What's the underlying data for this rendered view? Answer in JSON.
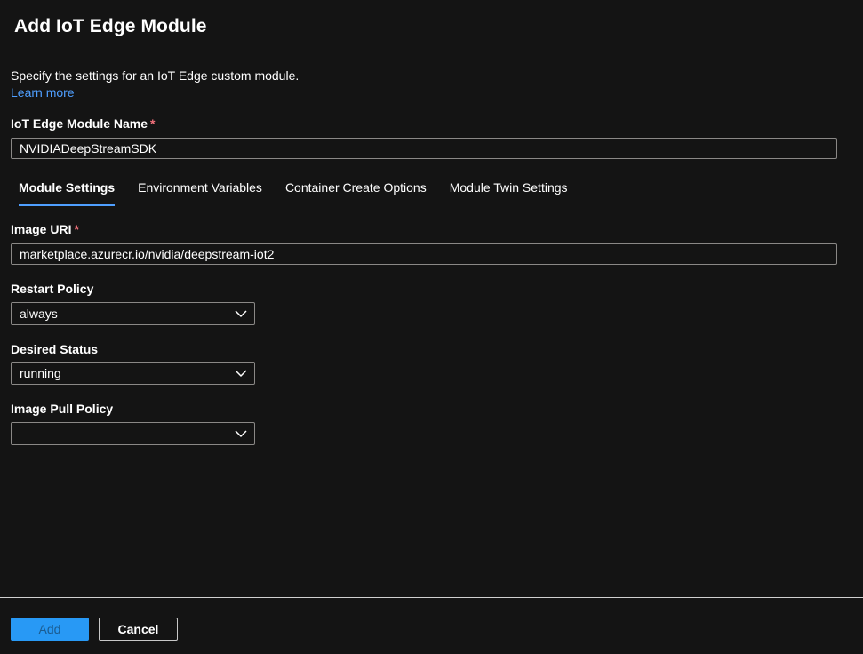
{
  "dialog": {
    "title": "Add IoT Edge Module",
    "description": "Specify the settings for an IoT Edge custom module.",
    "learn_more": "Learn more"
  },
  "module_name": {
    "label": "IoT Edge Module Name",
    "required_marker": "*",
    "value": "NVIDIADeepStreamSDK"
  },
  "tabs": [
    {
      "label": "Module Settings",
      "active": true
    },
    {
      "label": "Environment Variables",
      "active": false
    },
    {
      "label": "Container Create Options",
      "active": false
    },
    {
      "label": "Module Twin Settings",
      "active": false
    }
  ],
  "image_uri": {
    "label": "Image URI",
    "required_marker": "*",
    "value": "marketplace.azurecr.io/nvidia/deepstream-iot2"
  },
  "restart_policy": {
    "label": "Restart Policy",
    "value": "always"
  },
  "desired_status": {
    "label": "Desired Status",
    "value": "running"
  },
  "image_pull_policy": {
    "label": "Image Pull Policy",
    "value": ""
  },
  "footer": {
    "add_label": "Add",
    "cancel_label": "Cancel"
  },
  "icons": {
    "dropdown": "chevron-down-icon"
  },
  "colors": {
    "background": "#141414",
    "link": "#4f9fff",
    "required": "#f1707b",
    "primary_button": "#2899f5",
    "tab_underline": "#4f9fff"
  }
}
